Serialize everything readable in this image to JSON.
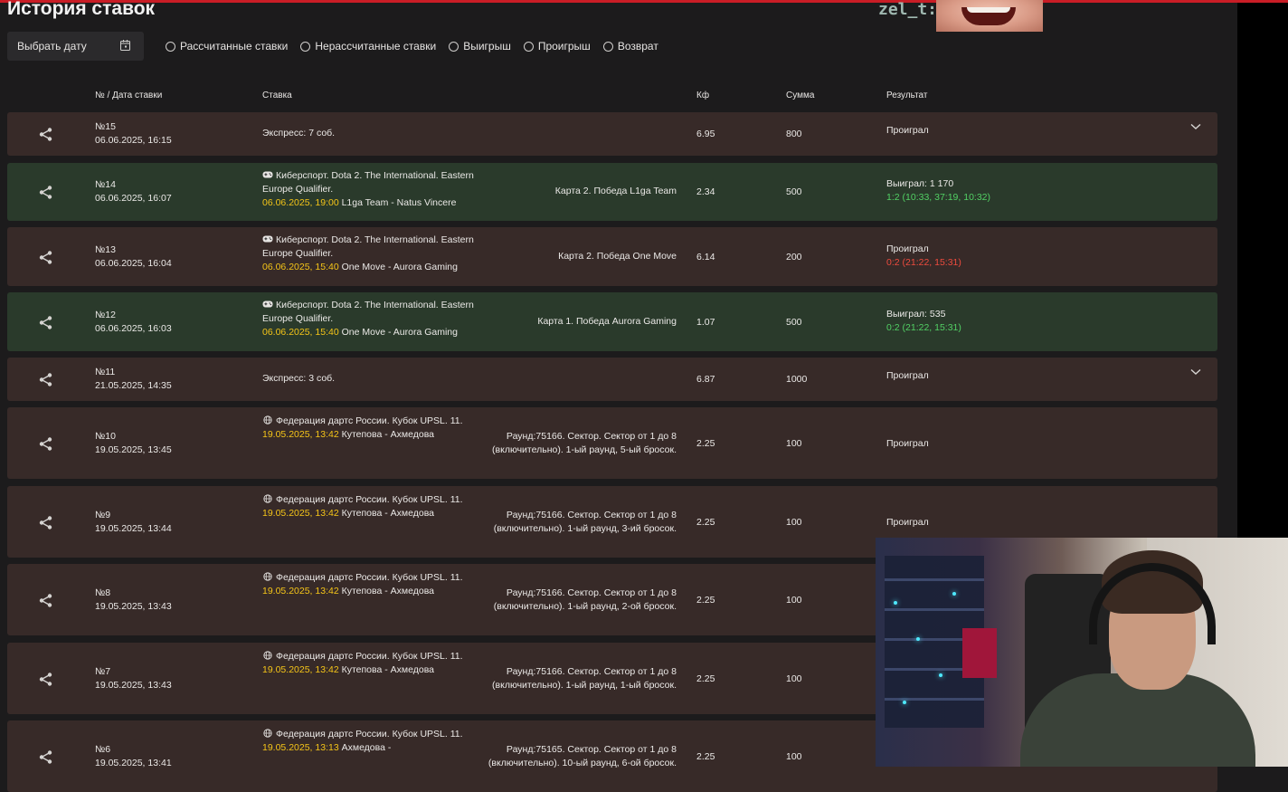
{
  "page": {
    "title": "История ставок"
  },
  "chat": {
    "username": "zel_t:"
  },
  "filters": {
    "date_button": "Выбрать дату",
    "options": [
      "Рассчитанные ставки",
      "Нерассчитанные ставки",
      "Выигрыш",
      "Проигрыш",
      "Возврат"
    ]
  },
  "table": {
    "headers": {
      "number_date": "№ / Дата ставки",
      "bet": "Ставка",
      "kf": "Кф",
      "sum": "Сумма",
      "result": "Результат"
    },
    "rows": [
      {
        "no": "№15",
        "date": "06.06.2025, 16:15",
        "desc": "Экспресс: 7 соб.",
        "kf": "6.95",
        "sum": "800",
        "result": "Проиграл",
        "expandable": true
      },
      {
        "no": "№14",
        "date": "06.06.2025, 16:07",
        "desc": "Киберспорт. Dota 2. The International. Eastern Europe Qualifier.",
        "event_time": "06.06.2025, 19:00",
        "teams": "L1ga Team - Natus Vincere",
        "pick": "Карта 2. Победа L1ga Team",
        "kf": "2.34",
        "sum": "500",
        "result": "Выиграл: 1 170",
        "score": "1:2 (10:33, 37:19, 10:32)"
      },
      {
        "no": "№13",
        "date": "06.06.2025, 16:04",
        "desc": "Киберспорт. Dota 2. The International. Eastern Europe Qualifier.",
        "event_time": "06.06.2025, 15:40",
        "teams": "One Move - Aurora Gaming",
        "pick": "Карта 2. Победа One Move",
        "kf": "6.14",
        "sum": "200",
        "result": "Проиграл",
        "score": "0:2 (21:22, 15:31)"
      },
      {
        "no": "№12",
        "date": "06.06.2025, 16:03",
        "desc": "Киберспорт. Dota 2. The International. Eastern Europe Qualifier.",
        "event_time": "06.06.2025, 15:40",
        "teams": "One Move - Aurora Gaming",
        "pick": "Карта 1. Победа Aurora Gaming",
        "kf": "1.07",
        "sum": "500",
        "result": "Выиграл: 535",
        "score": "0:2 (21:22, 15:31)"
      },
      {
        "no": "№11",
        "date": "21.05.2025, 14:35",
        "desc": "Экспресс: 3 соб.",
        "kf": "6.87",
        "sum": "1000",
        "result": "Проиграл",
        "expandable": true
      },
      {
        "no": "№10",
        "date": "19.05.2025, 13:45",
        "desc": "Федерация дартс России. Кубок UPSL. 11.",
        "event_time": "19.05.2025, 13:42",
        "teams": "Кутепова - Ахмедова",
        "pick": "Раунд:75166. Сектор. Сектор от 1 до 8 (включительно). 1-ый раунд, 5-ый бросок.",
        "kf": "2.25",
        "sum": "100",
        "result": "Проиграл"
      },
      {
        "no": "№9",
        "date": "19.05.2025, 13:44",
        "desc": "Федерация дартс России. Кубок UPSL. 11.",
        "event_time": "19.05.2025, 13:42",
        "teams": "Кутепова - Ахмедова",
        "pick": "Раунд:75166. Сектор. Сектор от 1 до 8 (включительно). 1-ый раунд, 3-ий бросок.",
        "kf": "2.25",
        "sum": "100",
        "result": "Проиграл"
      },
      {
        "no": "№8",
        "date": "19.05.2025, 13:43",
        "desc": "Федерация дартс России. Кубок UPSL. 11.",
        "event_time": "19.05.2025, 13:42",
        "teams": "Кутепова - Ахмедова",
        "pick": "Раунд:75166. Сектор. Сектор от 1 до 8 (включительно). 1-ый раунд, 2-ой бросок.",
        "kf": "2.25",
        "sum": "100",
        "result": ""
      },
      {
        "no": "№7",
        "date": "19.05.2025, 13:43",
        "desc": "Федерация дартс России. Кубок UPSL. 11.",
        "event_time": "19.05.2025, 13:42",
        "teams": "Кутепова - Ахмедова",
        "pick": "Раунд:75166. Сектор. Сектор от 1 до 8 (включительно). 1-ый раунд, 1-ый бросок.",
        "kf": "2.25",
        "sum": "100",
        "result": ""
      },
      {
        "no": "№6",
        "date": "19.05.2025, 13:41",
        "desc": "Федерация дартс России. Кубок UPSL. 11.",
        "event_time": "19.05.2025, 13:13",
        "teams": "Ахмедова -",
        "pick": "Раунд:75165. Сектор. Сектор от 1 до 8 (включительно). 10-ый раунд, 6-ой бросок.",
        "kf": "2.25",
        "sum": "100",
        "result": ""
      }
    ]
  }
}
